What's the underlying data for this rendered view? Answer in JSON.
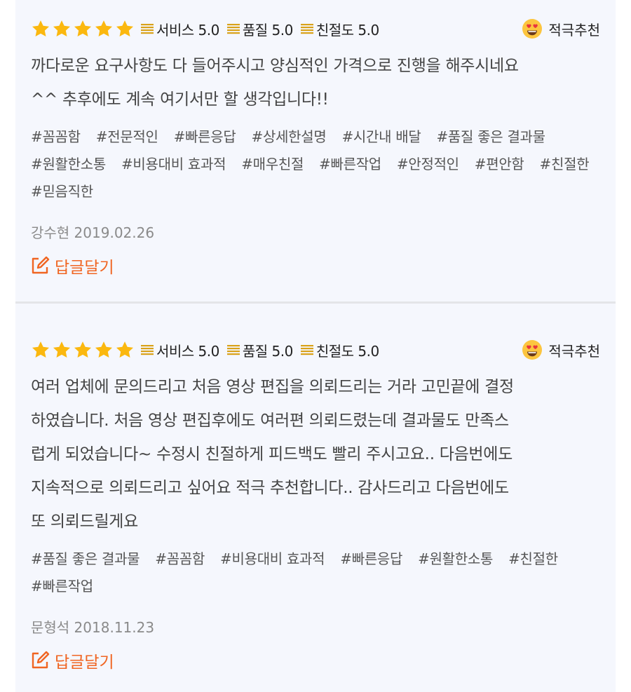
{
  "colors": {
    "accent": "#f06522",
    "star": "#fbb80f",
    "panel": "#f5f7fd",
    "meta_text": "#8a8a8a"
  },
  "reviews": [
    {
      "stars": 5,
      "scores": [
        {
          "label": "서비스 5.0",
          "icon": "rating-lines-icon"
        },
        {
          "label": "품질 5.0",
          "icon": "rating-lines-icon"
        },
        {
          "label": "친절도 5.0",
          "icon": "rating-lines-icon"
        }
      ],
      "recommend": {
        "label": "적극추천",
        "icon": "heart-eyes-emoji-icon"
      },
      "text_lines": [
        "까다로운 요구사항도 다 들어주시고 양심적인 가격으로 진행을 해주시네요",
        "^^ 추후에도 계속 여기서만 할 생각입니다!!"
      ],
      "tags": [
        "#꼼꼼함",
        "#전문적인",
        "#빠른응답",
        "#상세한설명",
        "#시간내 배달",
        "#품질 좋은 결과물",
        "#원활한소통",
        "#비용대비 효과적",
        "#매우친절",
        "#빠른작업",
        "#안정적인",
        "#편안함",
        "#친절한",
        "#믿음직한"
      ],
      "author_date": "강수현 2019.02.26",
      "reply_label": "답글달기"
    },
    {
      "stars": 5,
      "scores": [
        {
          "label": "서비스 5.0",
          "icon": "rating-lines-icon"
        },
        {
          "label": "품질 5.0",
          "icon": "rating-lines-icon"
        },
        {
          "label": "친절도 5.0",
          "icon": "rating-lines-icon"
        }
      ],
      "recommend": {
        "label": "적극추천",
        "icon": "heart-eyes-emoji-icon"
      },
      "text_lines": [
        "여러 업체에 문의드리고 처음 영상 편집을 의뢰드리는 거라 고민끝에 결정",
        "하였습니다. 처음 영상 편집후에도 여러편 의뢰드렸는데 결과물도 만족스",
        "럽게 되었습니다~ 수정시 친절하게 피드백도 빨리 주시고요.. 다음번에도",
        "지속적으로 의뢰드리고 싶어요 적극 추천합니다.. 감사드리고 다음번에도",
        "또 의뢰드릴게요"
      ],
      "tags": [
        "#품질 좋은 결과물",
        "#꼼꼼함",
        "#비용대비 효과적",
        "#빠른응답",
        "#원활한소통",
        "#친절한",
        "#빠른작업"
      ],
      "author_date": "문형석 2018.11.23",
      "reply_label": "답글달기"
    }
  ]
}
